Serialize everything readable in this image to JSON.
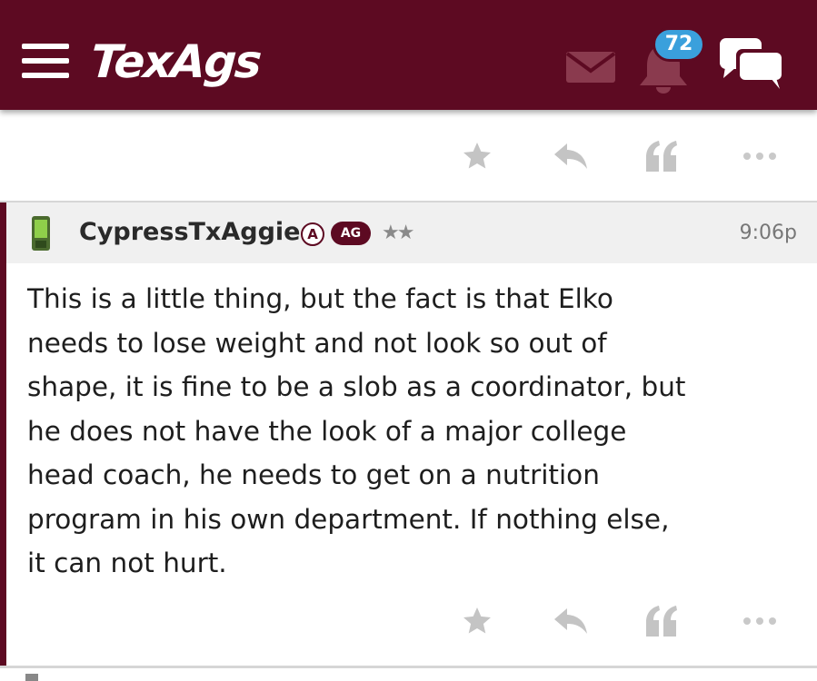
{
  "header": {
    "logo_text": "TexAgs",
    "notification_count": "72",
    "colors": {
      "brand": "#5d0a22",
      "badge": "#3aa0dc"
    },
    "icons": [
      "menu-icon",
      "mail-icon",
      "bell-icon",
      "chat-icon"
    ]
  },
  "previous_post": {
    "actions": [
      "star-icon",
      "reply-icon",
      "quote-icon",
      "more-icon"
    ]
  },
  "post": {
    "username": "CypressTxAggie",
    "badge_a": "A",
    "badge_ag": "AG",
    "stars": "★★",
    "time": "9:06p",
    "body": "This is a little thing, but the fact is that Elko\nneeds to lose weight and not look so out of\nshape, it is fine to be a slob as a coordinator, but\nhe does not have the look of a major college\nhead coach, he needs to get on a nutrition\nprogram in his own department. If nothing else,\nit can not hurt.",
    "actions": [
      "star-icon",
      "reply-icon",
      "quote-icon",
      "more-icon"
    ],
    "icon": "phone-icon"
  }
}
